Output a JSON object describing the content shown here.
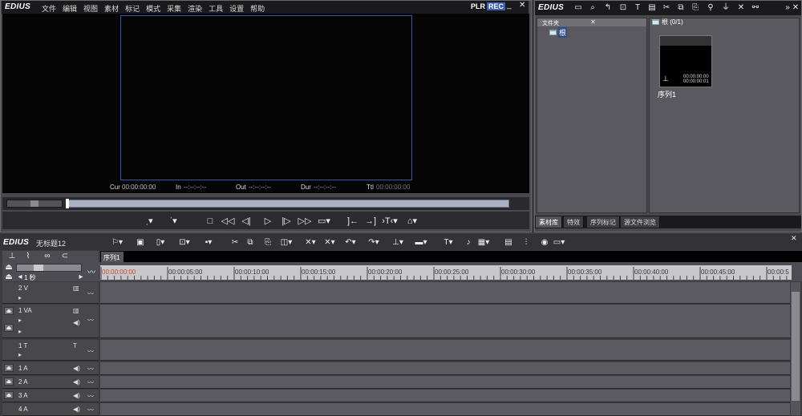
{
  "player": {
    "brand": "EDIUS",
    "menu": [
      "文件",
      "编辑",
      "视图",
      "素材",
      "标记",
      "模式",
      "采集",
      "渲染",
      "工具",
      "设置",
      "帮助"
    ],
    "plr": "PLR",
    "rec": "REC",
    "timecodes": {
      "cur_label": "Cur",
      "cur_value": "00:00:00:00",
      "in_label": "In",
      "in_value": "--:--:--:--",
      "out_label": "Out",
      "out_value": "--:--:--:--",
      "dur_label": "Dur",
      "dur_value": "--:--:--:--",
      "ttl_label": "Ttl",
      "ttl_value": "00:00:00:00"
    }
  },
  "bin": {
    "brand": "EDIUS",
    "folder_header": "文件夹",
    "root": "根",
    "clip_header": "根 (0/1)",
    "clip": {
      "name": "序列1",
      "tc1": "00:00:00:00",
      "tc2": "00:00:00:01"
    },
    "tabs": [
      "素材库",
      "特效",
      "序列标记",
      "源文件浏览"
    ]
  },
  "timeline": {
    "brand": "EDIUS",
    "project_title": "无标题12",
    "sequence_tab": "序列1",
    "zoom": "1 秒",
    "ruler": [
      "00:00:00:00",
      "00:00:05:00",
      "00:00:10:00",
      "00:00:15:00",
      "00:00:20:00",
      "00:00:25:00",
      "00:00:30:00",
      "00:00:35:00",
      "00:00:40:00",
      "00:00:45:00",
      "00:00:5"
    ],
    "tracks": {
      "v2": "2 V",
      "va1": "1 VA",
      "t1": "1 T",
      "a1": "1 A",
      "a2": "2 A",
      "a3": "3 A",
      "a4": "4 A"
    }
  },
  "colors": {
    "rec_accent": "#3a5fb8",
    "frame_border": "#3b56a8",
    "timecode_start": "#c54a2a",
    "panel": "#4a494e"
  }
}
